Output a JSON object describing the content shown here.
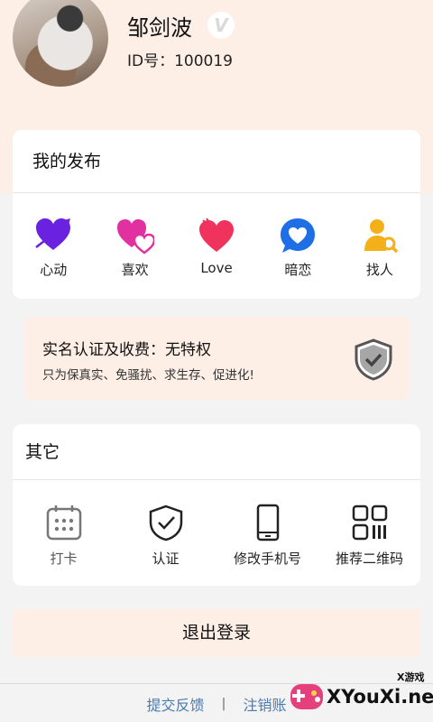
{
  "profile": {
    "username": "邹剑波",
    "badge": "V",
    "id_label": "ID号：100019"
  },
  "my_posts": {
    "title": "我的发布",
    "items": [
      {
        "label": "心动",
        "icon": "heart-arrow-icon",
        "color": "#6a22e0"
      },
      {
        "label": "喜欢",
        "icon": "double-heart-icon",
        "color": "#e1309f"
      },
      {
        "label": "Love",
        "icon": "heart-icon",
        "color": "#f0335c"
      },
      {
        "label": "暗恋",
        "icon": "heart-bubble-icon",
        "color": "#1e6fe6"
      },
      {
        "label": "找人",
        "icon": "person-search-icon",
        "color": "#f4b018"
      }
    ]
  },
  "auth": {
    "title": "实名认证及收费：无特权",
    "subtitle": "只为保真实、免骚扰、求生存、促进化!"
  },
  "other": {
    "title": "其它",
    "items": [
      {
        "label": "打卡",
        "icon": "calendar-icon"
      },
      {
        "label": "认证",
        "icon": "shield-check-icon"
      },
      {
        "label": "修改手机号",
        "icon": "phone-icon"
      },
      {
        "label": "推荐二维码",
        "icon": "qr-code-icon"
      }
    ]
  },
  "logout_label": "退出登录",
  "footer": {
    "feedback": "提交反馈",
    "separator": "|",
    "cancel_account": "注销账"
  },
  "watermark": {
    "text": "XYouXi.net",
    "small": "X游戏"
  }
}
